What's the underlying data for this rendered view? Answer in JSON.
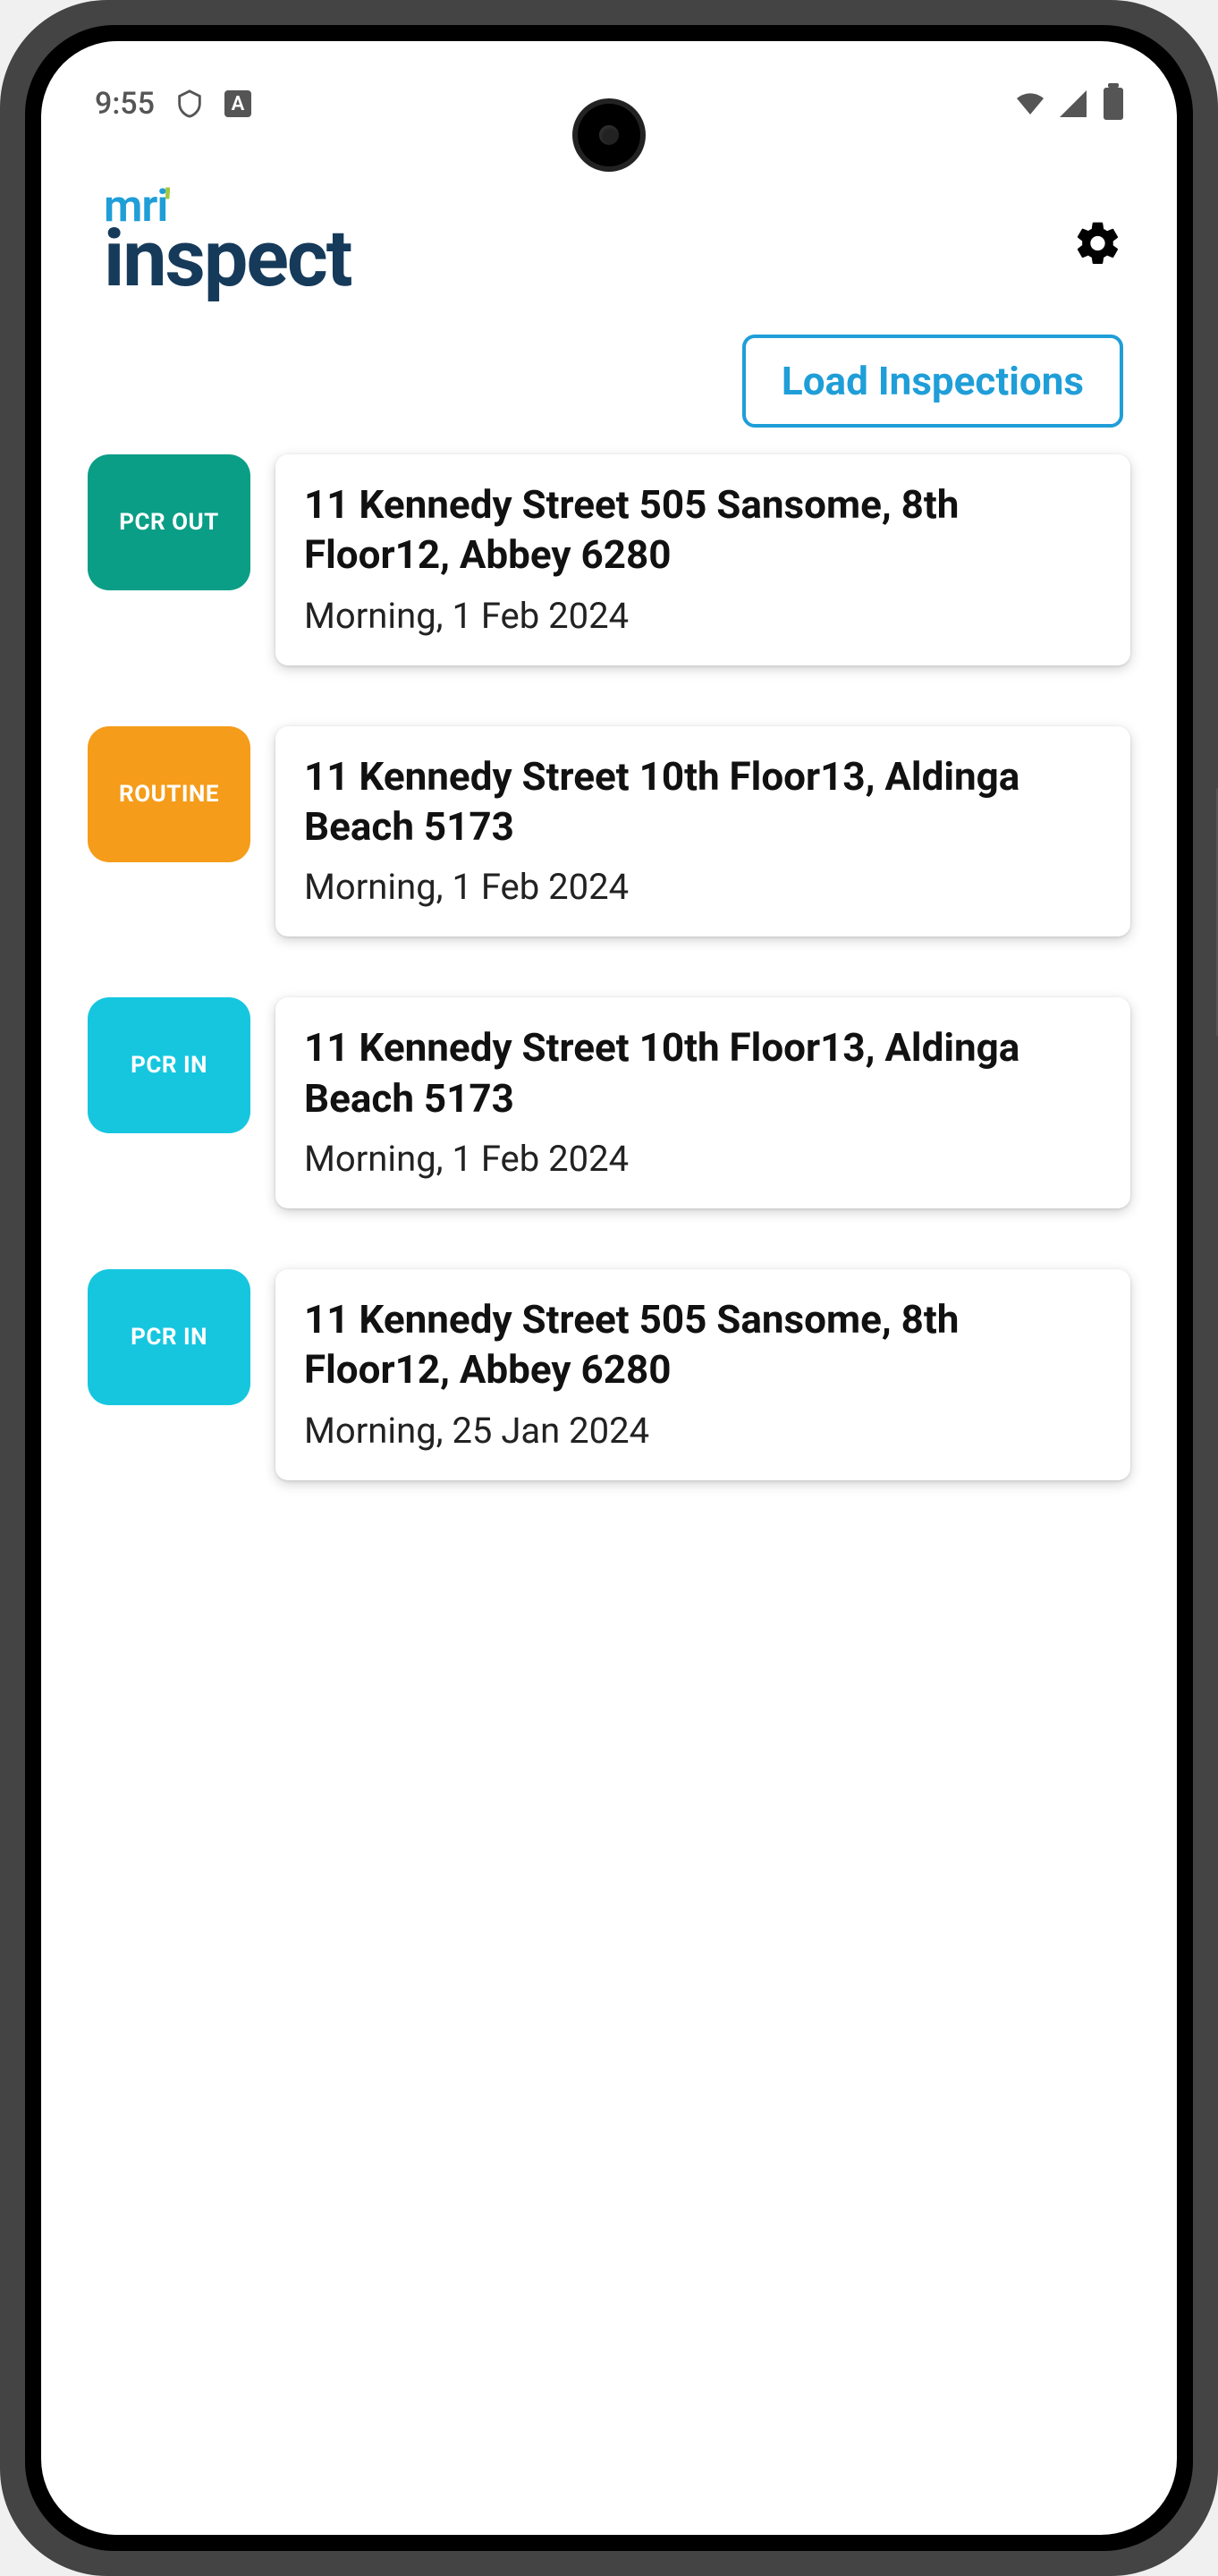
{
  "status": {
    "time": "9:55",
    "a_badge": "A"
  },
  "app": {
    "logo_top": "mri",
    "logo_bottom": "inspect"
  },
  "actions": {
    "load_label": "Load Inspections"
  },
  "tag_colors": {
    "PCR_OUT": "#0a9e86",
    "ROUTINE": "#f59c1a",
    "PCR_IN": "#16c6df"
  },
  "inspections": [
    {
      "tag": "PCR OUT",
      "tag_color_key": "PCR_OUT",
      "address": "11 Kennedy Street 505 Sansome, 8th Floor12, Abbey 6280",
      "time": "Morning, 1 Feb 2024"
    },
    {
      "tag": "ROUTINE",
      "tag_color_key": "ROUTINE",
      "address": "11 Kennedy Street 10th Floor13, Aldinga Beach 5173",
      "time": "Morning, 1 Feb 2024"
    },
    {
      "tag": "PCR IN",
      "tag_color_key": "PCR_IN",
      "address": "11 Kennedy Street 10th Floor13, Aldinga Beach 5173",
      "time": "Morning, 1 Feb 2024"
    },
    {
      "tag": "PCR IN",
      "tag_color_key": "PCR_IN",
      "address": "11 Kennedy Street 505 Sansome, 8th Floor12, Abbey 6280",
      "time": "Morning, 25 Jan 2024"
    }
  ]
}
